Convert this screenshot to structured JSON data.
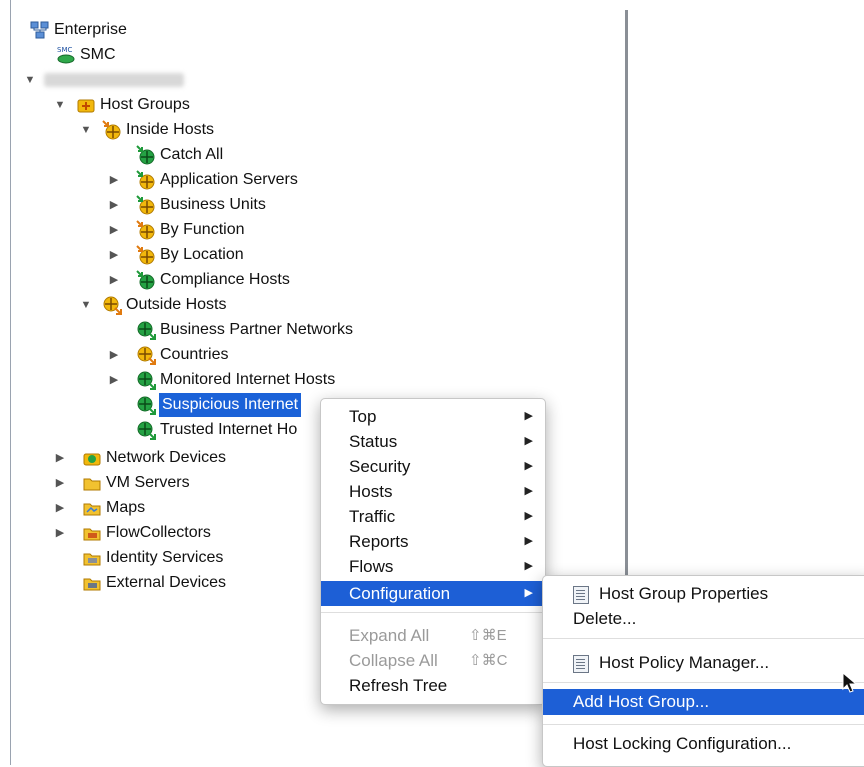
{
  "tree": {
    "items": [
      {
        "label": "Enterprise",
        "icon": "enterprise-icon"
      },
      {
        "label": "SMC",
        "icon": "smc-icon"
      },
      {
        "label": "",
        "icon": "",
        "blurred": true
      },
      {
        "label": "Host Groups",
        "icon": "host-groups-icon"
      },
      {
        "label": "Inside Hosts",
        "icon": "inside-hosts-icon"
      },
      {
        "label": "Catch All",
        "icon": "inside-host-green-icon"
      },
      {
        "label": "Application Servers",
        "icon": "inside-host-icon"
      },
      {
        "label": "Business Units",
        "icon": "inside-host-icon"
      },
      {
        "label": "By Function",
        "icon": "inside-host-icon"
      },
      {
        "label": "By Location",
        "icon": "inside-host-icon"
      },
      {
        "label": "Compliance Hosts",
        "icon": "inside-host-green-icon"
      },
      {
        "label": "Outside Hosts",
        "icon": "outside-hosts-icon"
      },
      {
        "label": "Business Partner Networks",
        "icon": "outside-host-green-icon"
      },
      {
        "label": "Countries",
        "icon": "outside-host-icon"
      },
      {
        "label": "Monitored Internet Hosts",
        "icon": "outside-host-green-icon"
      },
      {
        "label": "Suspicious Internet",
        "icon": "outside-host-green-icon"
      },
      {
        "label": "Trusted Internet Ho",
        "icon": "outside-host-green-icon"
      },
      {
        "label": "Network Devices",
        "icon": "network-devices-icon"
      },
      {
        "label": "VM Servers",
        "icon": "folder-icon"
      },
      {
        "label": "Maps",
        "icon": "maps-icon"
      },
      {
        "label": "FlowCollectors",
        "icon": "flowcollectors-icon"
      },
      {
        "label": "Identity Services",
        "icon": "identity-services-icon"
      },
      {
        "label": "External Devices",
        "icon": "external-devices-icon"
      }
    ]
  },
  "context_menu": {
    "items": [
      {
        "label": "Top"
      },
      {
        "label": "Status"
      },
      {
        "label": "Security"
      },
      {
        "label": "Hosts"
      },
      {
        "label": "Traffic"
      },
      {
        "label": "Reports"
      },
      {
        "label": "Flows"
      },
      {
        "label": "Configuration"
      }
    ],
    "expand_all": "Expand All",
    "expand_all_shortcut": "⇧⌘E",
    "collapse_all": "Collapse All",
    "collapse_all_shortcut": "⇧⌘C",
    "refresh_tree": "Refresh Tree"
  },
  "submenu": {
    "host_group_properties": "Host Group Properties",
    "delete": "Delete...",
    "host_policy_manager": "Host Policy Manager...",
    "add_host_group": "Add Host Group...",
    "host_locking_configuration": "Host Locking Configuration..."
  },
  "colors": {
    "selection": "#1b62d8",
    "menu_highlight": "#1d5fd6",
    "inside_host_yellow": "#f2b80c",
    "host_green": "#25a244",
    "arrow_green": "#1f9a3a",
    "arrow_orange": "#e07a10"
  }
}
